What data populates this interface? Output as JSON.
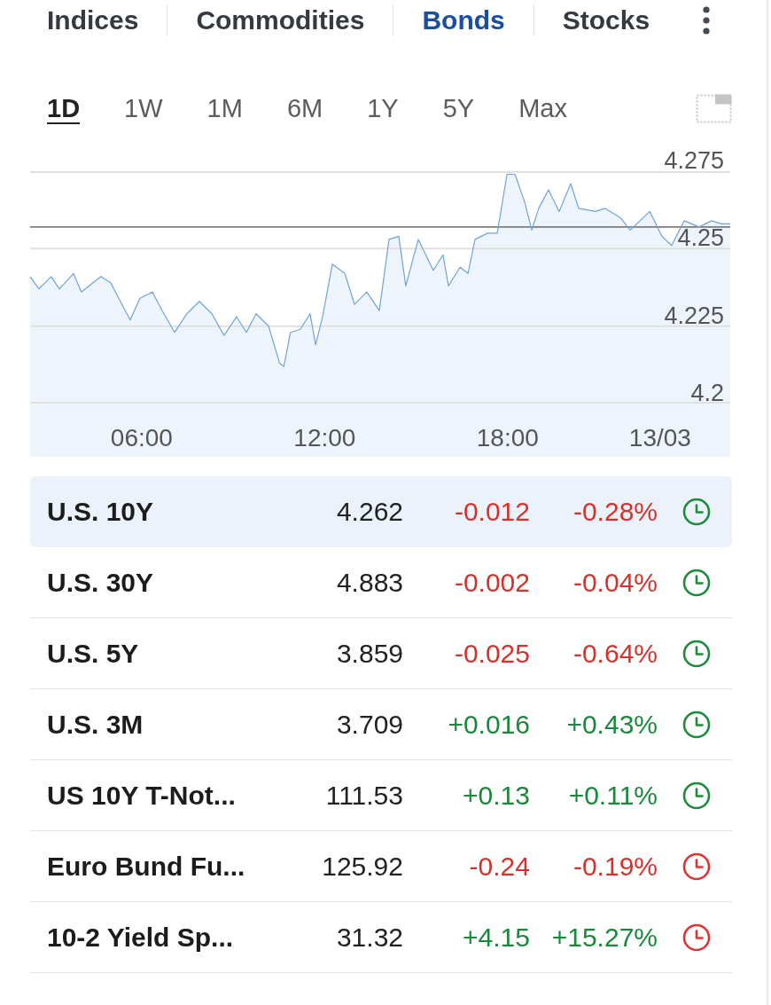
{
  "tabs": [
    {
      "label": "Indices",
      "selected": false
    },
    {
      "label": "Commodities",
      "selected": false
    },
    {
      "label": "Bonds",
      "selected": true
    },
    {
      "label": "Stocks",
      "selected": false
    }
  ],
  "time_ranges": [
    {
      "label": "1D",
      "selected": true
    },
    {
      "label": "1W",
      "selected": false
    },
    {
      "label": "1M",
      "selected": false
    },
    {
      "label": "6M",
      "selected": false
    },
    {
      "label": "1Y",
      "selected": false
    },
    {
      "label": "5Y",
      "selected": false
    },
    {
      "label": "Max",
      "selected": false
    }
  ],
  "chart": {
    "chart_data": {
      "type": "area",
      "x": [
        2.34,
        2.63,
        3.03,
        3.3,
        3.76,
        4.02,
        4.66,
        4.98,
        5.62,
        5.94,
        6.35,
        6.67,
        7.08,
        7.48,
        7.89,
        8.3,
        8.7,
        9.11,
        9.43,
        9.75,
        10.16,
        10.52,
        10.66,
        10.88,
        11.2,
        11.52,
        11.7,
        11.93,
        12.25,
        12.66,
        12.98,
        13.38,
        13.79,
        14.11,
        14.43,
        14.66,
        15.07,
        15.56,
        15.88,
        16.06,
        16.44,
        16.7,
        16.93,
        17.34,
        17.66,
        17.98,
        18.24,
        18.56,
        18.79,
        19.02,
        19.34,
        19.69,
        20.07,
        20.33,
        20.88,
        21.2,
        21.7,
        22.02,
        22.66,
        23.06,
        23.38,
        23.79,
        24.28,
        24.69,
        25.01,
        25.3
      ],
      "series": [
        {
          "color": "#6fa3d9",
          "values": [
            4.241,
            4.237,
            4.241,
            4.237,
            4.242,
            4.236,
            4.241,
            4.239,
            4.227,
            4.234,
            4.236,
            4.23,
            4.223,
            4.229,
            4.233,
            4.229,
            4.222,
            4.228,
            4.223,
            4.229,
            4.225,
            4.213,
            4.212,
            4.223,
            4.224,
            4.229,
            4.219,
            4.228,
            4.245,
            4.242,
            4.232,
            4.236,
            4.23,
            4.253,
            4.254,
            4.238,
            4.253,
            4.243,
            4.248,
            4.238,
            4.244,
            4.242,
            4.253,
            4.255,
            4.255,
            4.274,
            4.274,
            4.265,
            4.256,
            4.263,
            4.269,
            4.262,
            4.271,
            4.263,
            4.262,
            4.263,
            4.26,
            4.256,
            4.262,
            4.254,
            4.251,
            4.259,
            4.257,
            4.259,
            4.258,
            4.258
          ]
        }
      ],
      "xlim": [
        2.34,
        25.3
      ],
      "ylim": [
        4.2,
        4.275
      ],
      "xticks": [
        {
          "value": 6,
          "label": "06:00"
        },
        {
          "value": 12,
          "label": "12:00"
        },
        {
          "value": 18,
          "label": "18:00"
        },
        {
          "value": 23,
          "label": "13/03"
        }
      ],
      "yticks": [
        4.2,
        4.225,
        4.25,
        4.275
      ],
      "grid": true,
      "ref_lines": [
        {
          "axis": "y",
          "value": 4.257
        }
      ]
    }
  },
  "table": {
    "rows": [
      {
        "name": "U.S. 10Y",
        "price": "4.262",
        "change": "-0.012",
        "percent_change": "-0.28%",
        "negative": true,
        "color": "#1e8a3c",
        "selected": true
      },
      {
        "name": "U.S. 30Y",
        "price": "4.883",
        "change": "-0.002",
        "percent_change": "-0.04%",
        "negative": true,
        "color": "#1e8a3c",
        "selected": false
      },
      {
        "name": "U.S. 5Y",
        "price": "3.859",
        "change": "-0.025",
        "percent_change": "-0.64%",
        "negative": true,
        "color": "#1e8a3c",
        "selected": false
      },
      {
        "name": "U.S. 3M",
        "price": "3.709",
        "change": "+0.016",
        "percent_change": "+0.43%",
        "negative": false,
        "color": "#1e8a3c",
        "selected": false
      },
      {
        "name": "US 10Y T-Not...",
        "price": "111.53",
        "change": "+0.13",
        "percent_change": "+0.11%",
        "negative": false,
        "color": "#1e8a3c",
        "selected": false
      },
      {
        "name": "Euro Bund Fu...",
        "price": "125.92",
        "change": "-0.24",
        "percent_change": "-0.19%",
        "negative": true,
        "color": "#e03434",
        "selected": false
      },
      {
        "name": "10-2 Yield Sp...",
        "price": "31.32",
        "change": "+4.15",
        "percent_change": "+15.27%",
        "negative": false,
        "color": "#e03434",
        "selected": false
      }
    ]
  }
}
